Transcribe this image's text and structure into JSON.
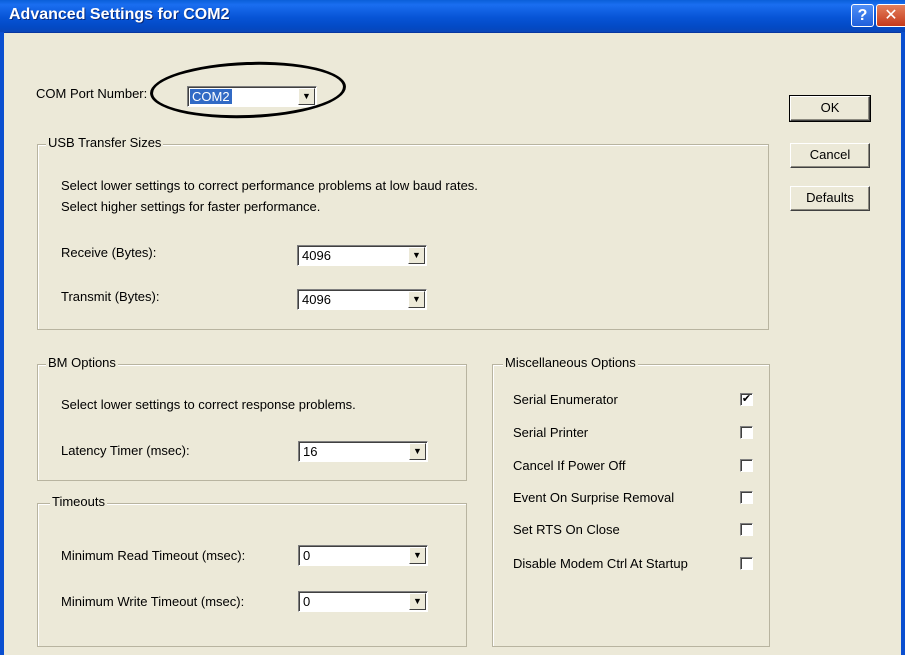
{
  "window": {
    "title": "Advanced Settings for COM2",
    "help_glyph": "?",
    "close_glyph": "✕"
  },
  "com_port": {
    "label": "COM Port Number:",
    "value": "COM2"
  },
  "buttons": {
    "ok": "OK",
    "cancel": "Cancel",
    "defaults": "Defaults"
  },
  "usb_transfer": {
    "title": "USB Transfer Sizes",
    "desc1": "Select lower settings to correct performance problems at low baud rates.",
    "desc2": "Select higher settings for faster performance.",
    "receive_label": "Receive (Bytes):",
    "receive_value": "4096",
    "transmit_label": "Transmit (Bytes):",
    "transmit_value": "4096"
  },
  "bm_options": {
    "title": "BM Options",
    "desc": "Select lower settings to correct response problems.",
    "latency_label": "Latency Timer (msec):",
    "latency_value": "16"
  },
  "timeouts": {
    "title": "Timeouts",
    "min_read_label": "Minimum Read Timeout (msec):",
    "min_read_value": "0",
    "min_write_label": "Minimum Write Timeout (msec):",
    "min_write_value": "0"
  },
  "misc": {
    "title": "Miscellaneous Options",
    "options": [
      {
        "label": "Serial Enumerator",
        "checked": true
      },
      {
        "label": "Serial Printer",
        "checked": false
      },
      {
        "label": "Cancel If Power Off",
        "checked": false
      },
      {
        "label": "Event On Surprise Removal",
        "checked": false
      },
      {
        "label": "Set RTS On Close",
        "checked": false
      },
      {
        "label": "Disable Modem Ctrl At Startup",
        "checked": false
      }
    ]
  },
  "glyphs": {
    "dropdown_arrow": "▼",
    "check_mark": "✔"
  },
  "colors": {
    "title_bar": "#0754d6",
    "dialog_bg": "#ece9d8",
    "selection": "#316ac5"
  }
}
